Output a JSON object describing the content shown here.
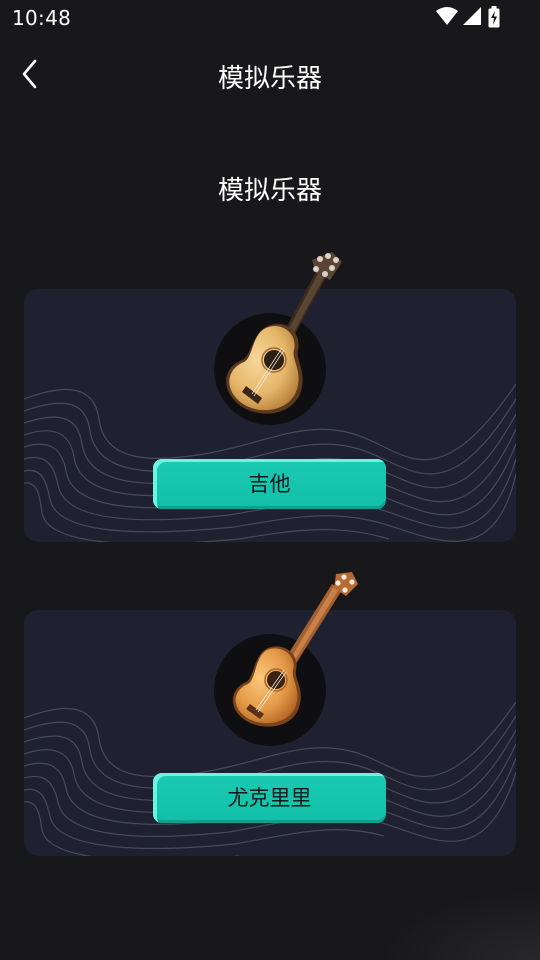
{
  "status_bar": {
    "time": "10:48",
    "icons": [
      "wifi-icon",
      "signal-icon",
      "battery-charging-icon"
    ]
  },
  "app_bar": {
    "back_icon": "chevron-left-icon",
    "title": "模拟乐器"
  },
  "section": {
    "title": "模拟乐器"
  },
  "instruments": [
    {
      "label": "吉他",
      "icon": "acoustic-guitar-icon"
    },
    {
      "label": "尤克里里",
      "icon": "ukulele-icon"
    }
  ],
  "colors": {
    "background": "#18181a",
    "card": "#1f2130",
    "button": "#18c4ad",
    "button_highlight": "#6ff3e0",
    "text": "#ffffff",
    "button_text": "#111a19"
  }
}
